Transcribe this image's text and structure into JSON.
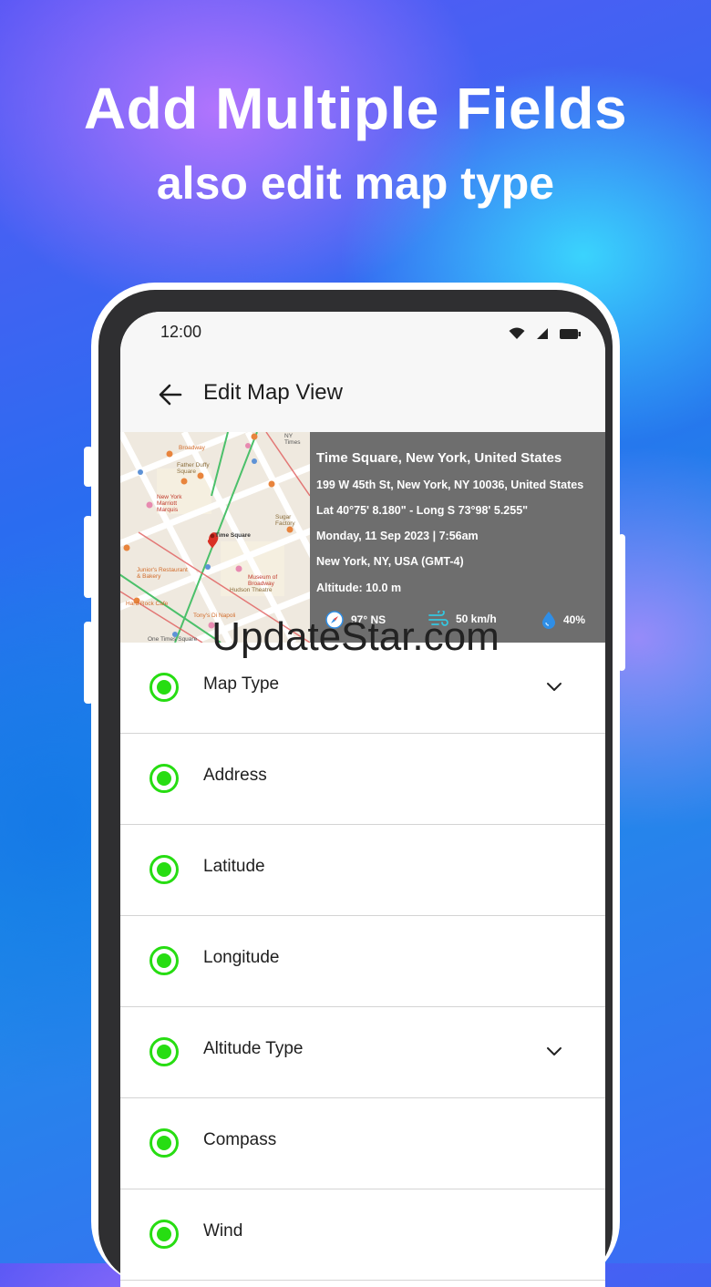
{
  "promo": {
    "headline": "Add Multiple Fields",
    "subline": "also edit map type"
  },
  "status_bar": {
    "time": "12:00",
    "icons": [
      "wifi-icon",
      "signal-icon",
      "battery-icon"
    ]
  },
  "app_bar": {
    "back_icon": "arrow-left-icon",
    "title": "Edit Map View"
  },
  "map_labels": {
    "nyt": "NY Times",
    "broadway": "Broadway",
    "father_duffy": "Father Duffy Square",
    "marriott": "New York Marriott Marquis",
    "times_square": "Time Square",
    "sugar": "Sugar Factory",
    "juniors": "Junior's Restaurant & Bakery",
    "hard_rock": "Hard Rock Cafe",
    "museum_broadway": "Museum of Broadway",
    "hudson": "Hudson Theatre",
    "tonys": "Tony's Di Napoli",
    "one_times": "One Times Square"
  },
  "geo_info": {
    "place": "Time Square, New York, United States",
    "address": "199 W 45th St, New York, NY 10036, United States",
    "coords": "Lat 40°75' 8.180\" - Long S 73°98' 5.255\"",
    "datetime": "Monday, 11 Sep 2023 | 7:56am",
    "timezone": "New York, NY, USA (GMT-4)",
    "altitude": "Altitude: 10.0 m",
    "compass": "97° NS",
    "wind": "50 km/h",
    "humidity": "40%"
  },
  "watermark": "UpdateStar.com",
  "fields": [
    {
      "label": "Map Type",
      "has_dropdown": true
    },
    {
      "label": "Address",
      "has_dropdown": false
    },
    {
      "label": "Latitude",
      "has_dropdown": false
    },
    {
      "label": "Longitude",
      "has_dropdown": false
    },
    {
      "label": "Altitude Type",
      "has_dropdown": true
    },
    {
      "label": "Compass",
      "has_dropdown": false
    },
    {
      "label": "Wind",
      "has_dropdown": false
    }
  ],
  "colors": {
    "accent_green": "#27dd12",
    "overlay_gray": "#6e6e6e",
    "compass_blue": "#2f8ee6",
    "wind_cyan": "#34c7e0"
  }
}
